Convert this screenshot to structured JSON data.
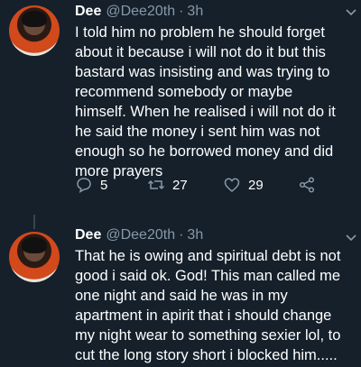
{
  "tweets": [
    {
      "name": "Dee",
      "handle": "@Dee20th",
      "separator": "·",
      "time": "3h",
      "text": "I told him no problem he should forget\nabout it because i will not do it but this\nbastard was insisting and was trying to\nrecommend somebody or maybe\nhimself. When he realised i will not do it\nhe said the money i sent him was not\nenough so he borrowed money and did\nmore prayers",
      "replies": "5",
      "retweets": "27",
      "likes": "29",
      "icons": [
        "reply-icon",
        "retweet-icon",
        "like-icon",
        "share-icon"
      ]
    },
    {
      "name": "Dee",
      "handle": "@Dee20th",
      "separator": "·",
      "time": "3h",
      "text": "That he is owing and spiritual debt is not\ngood i said ok. God! This man called me\none night and said he was in my\napartment in apirit that i should change\nmy night wear to something sexier lol, to\ncut the long story short i blocked him....."
    }
  ],
  "colors": {
    "background": "#15202b",
    "secondary_text": "#8899a6",
    "primary_text": "#ffffff",
    "thread_line": "#38444d"
  }
}
